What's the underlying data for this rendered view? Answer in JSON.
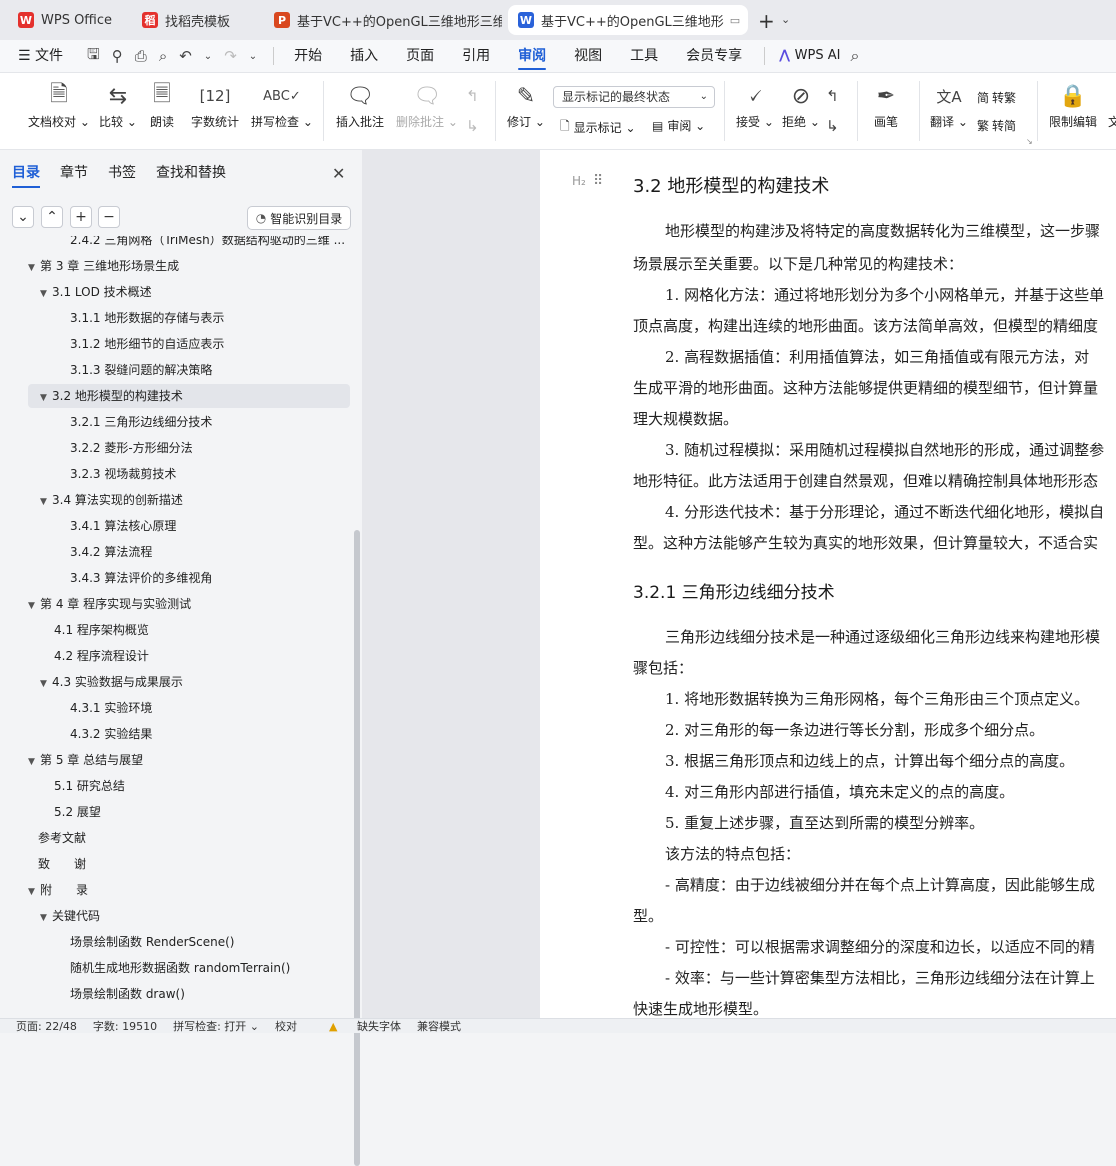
{
  "tabs": [
    {
      "label": "WPS Office",
      "icon": "W",
      "color": "#e4312d"
    },
    {
      "label": "找稻壳模板",
      "icon": "稻",
      "color": "#e4312d"
    },
    {
      "label": "基于VC++的OpenGL三维地形三维可",
      "icon": "P",
      "color": "#d9481f"
    },
    {
      "label": "基于VC++的OpenGL三维地形",
      "icon": "W",
      "color": "#2a62d9"
    }
  ],
  "new_tab": "+",
  "menu": {
    "file": "文件",
    "items": [
      "开始",
      "插入",
      "页面",
      "引用",
      "审阅",
      "视图",
      "工具",
      "会员专享"
    ],
    "active": "审阅",
    "wps_ai": "WPS AI"
  },
  "ribbon": {
    "doc_check": "文档校对",
    "compare": "比较",
    "read": "朗读",
    "word_count": "字数统计",
    "spell_check": "拼写检查",
    "insert_comment": "插入批注",
    "delete_comment": "删除批注",
    "revise": "修订",
    "show_mode": "显示标记的最终状态",
    "show_marks": "显示标记",
    "review": "审阅",
    "accept": "接受",
    "reject": "拒绝",
    "pen": "画笔",
    "translate": "翻译",
    "to_traditional": "转繁",
    "to_simplified": "转简",
    "restrict_edit": "限制编辑",
    "more": "文"
  },
  "sidebar": {
    "tabs": [
      "目录",
      "章节",
      "书签",
      "查找和替换"
    ],
    "smart_toc": "智能识别目录",
    "toc": [
      {
        "label": "2.4.2  三角网格（TriMesh）数据结构驱动的三维 ...",
        "level": 3,
        "arrow": ""
      },
      {
        "label": "第 3 章  三维地形场景生成",
        "level": 1,
        "arrow": "▼"
      },
      {
        "label": "3.1 LOD 技术概述",
        "level": 2,
        "arrow": "▼"
      },
      {
        "label": "3.1.1  地形数据的存储与表示",
        "level": 3,
        "arrow": ""
      },
      {
        "label": "3.1.2  地形细节的自适应表示",
        "level": 3,
        "arrow": ""
      },
      {
        "label": "3.1.3  裂缝问题的解决策略",
        "level": 3,
        "arrow": ""
      },
      {
        "label": "3.2  地形模型的构建技术",
        "level": 2,
        "arrow": "▼",
        "selected": true
      },
      {
        "label": "3.2.1  三角形边线细分技术",
        "level": 3,
        "arrow": ""
      },
      {
        "label": "3.2.2  菱形-方形细分法",
        "level": 3,
        "arrow": ""
      },
      {
        "label": "3.2.3  视场裁剪技术",
        "level": 3,
        "arrow": ""
      },
      {
        "label": "3.4  算法实现的创新描述",
        "level": 2,
        "arrow": "▼"
      },
      {
        "label": "3.4.1  算法核心原理",
        "level": 3,
        "arrow": ""
      },
      {
        "label": "3.4.2  算法流程",
        "level": 3,
        "arrow": ""
      },
      {
        "label": "3.4.3  算法评价的多维视角",
        "level": 3,
        "arrow": ""
      },
      {
        "label": "第 4 章  程序实现与实验测试",
        "level": 1,
        "arrow": "▼"
      },
      {
        "label": "4.1  程序架构概览",
        "level": 2,
        "arrow": ""
      },
      {
        "label": "4.2  程序流程设计",
        "level": 2,
        "arrow": ""
      },
      {
        "label": "4.3  实验数据与成果展示",
        "level": 2,
        "arrow": "▼"
      },
      {
        "label": "4.3.1  实验环境",
        "level": 3,
        "arrow": ""
      },
      {
        "label": "4.3.2  实验结果",
        "level": 3,
        "arrow": ""
      },
      {
        "label": "第 5 章  总结与展望",
        "level": 1,
        "arrow": "▼"
      },
      {
        "label": "5.1  研究总结",
        "level": 2,
        "arrow": ""
      },
      {
        "label": "5.2  展望",
        "level": 2,
        "arrow": ""
      },
      {
        "label": "参考文献",
        "level": 1,
        "arrow": ""
      },
      {
        "label": "致　　谢",
        "level": 1,
        "arrow": ""
      },
      {
        "label": "附　　录",
        "level": 1,
        "arrow": "▼"
      },
      {
        "label": "关键代码",
        "level": 2,
        "arrow": "▼"
      },
      {
        "label": "场景绘制函数 RenderScene()",
        "level": 3,
        "arrow": ""
      },
      {
        "label": "随机生成地形数据函数 randomTerrain()",
        "level": 3,
        "arrow": ""
      },
      {
        "label": "场景绘制函数 draw()",
        "level": 3,
        "arrow": ""
      }
    ]
  },
  "doc": {
    "heading_marker": "H₂",
    "lines": [
      {
        "text": "3.2  地形模型的构建技术",
        "style": "h2"
      },
      {
        "text": "地形模型的构建涉及将特定的高度数据转化为三维模型，这一步骤",
        "style": "ind"
      },
      {
        "text": "场景展示至关重要。以下是几种常见的构建技术：",
        "style": "p"
      },
      {
        "text": "1. 网格化方法：通过将地形划分为多个小网格单元，并基于这些单",
        "style": "ind"
      },
      {
        "text": "顶点高度，构建出连续的地形曲面。该方法简单高效，但模型的精细度",
        "style": "p"
      },
      {
        "text": "2. 高程数据插值：利用插值算法，如三角插值或有限元方法，对",
        "style": "ind"
      },
      {
        "text": "生成平滑的地形曲面。这种方法能够提供更精细的模型细节，但计算量",
        "style": "p"
      },
      {
        "text": "理大规模数据。",
        "style": "p"
      },
      {
        "text": "3. 随机过程模拟：采用随机过程模拟自然地形的形成，通过调整参",
        "style": "ind"
      },
      {
        "text": "地形特征。此方法适用于创建自然景观，但难以精确控制具体地形形态",
        "style": "p"
      },
      {
        "text": "4. 分形迭代技术：基于分形理论，通过不断迭代细化地形，模拟自",
        "style": "ind"
      },
      {
        "text": "型。这种方法能够产生较为真实的地形效果，但计算量较大，不适合实",
        "style": "p"
      },
      {
        "text": "3.2.1  三角形边线细分技术",
        "style": "h3"
      },
      {
        "text": "三角形边线细分技术是一种通过逐级细化三角形边线来构建地形模",
        "style": "ind"
      },
      {
        "text": "骤包括：",
        "style": "p"
      },
      {
        "text": "1. 将地形数据转换为三角形网格，每个三角形由三个顶点定义。",
        "style": "ind"
      },
      {
        "text": "2. 对三角形的每一条边进行等长分割，形成多个细分点。",
        "style": "ind"
      },
      {
        "text": "3. 根据三角形顶点和边线上的点，计算出每个细分点的高度。",
        "style": "ind"
      },
      {
        "text": "4. 对三角形内部进行插值，填充未定义的点的高度。",
        "style": "ind"
      },
      {
        "text": "5. 重复上述步骤，直至达到所需的模型分辨率。",
        "style": "ind"
      },
      {
        "text": "该方法的特点包括：",
        "style": "ind"
      },
      {
        "text": "- 高精度：由于边线被细分并在每个点上计算高度，因此能够生成",
        "style": "ind"
      },
      {
        "text": "型。",
        "style": "p"
      },
      {
        "text": "- 可控性：可以根据需求调整细分的深度和边长，以适应不同的精",
        "style": "ind"
      },
      {
        "text": "- 效率：与一些计算密集型方法相比，三角形边线细分法在计算上",
        "style": "ind"
      },
      {
        "text": "快速生成地形模型。",
        "style": "p"
      }
    ]
  },
  "status": {
    "page": "页面: 22/48",
    "words": "字数: 19510",
    "spell": "拼写检查: 打开 ⌄",
    "proof": "校对",
    "missing_font": "缺失字体",
    "compat": "兼容模式"
  }
}
